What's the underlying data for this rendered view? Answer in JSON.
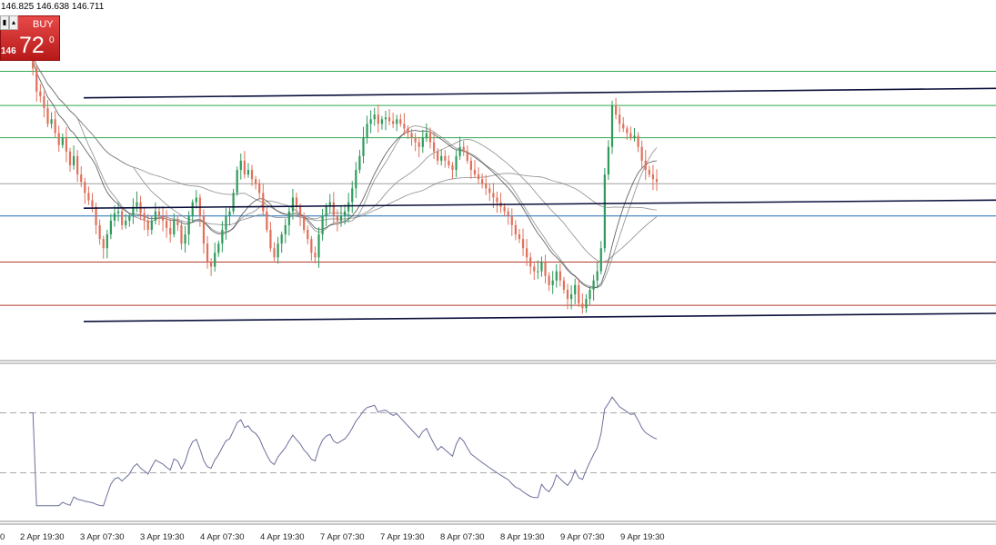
{
  "header": {
    "ohlc_text": "146.825 146.638 146.711"
  },
  "trade_panel": {
    "buy_label": "BUY",
    "price_small": "146",
    "price_big": "72",
    "price_sup": "0",
    "sell_icon": "minus-box-icon",
    "up_icon": "up-arrow-icon",
    "buy_color": "#d22b2b"
  },
  "chart_data": {
    "type": "candlestick",
    "time_axis_labels": [
      "0",
      "2 Apr 19:30",
      "3 Apr 07:30",
      "3 Apr 19:30",
      "4 Apr 07:30",
      "4 Apr 19:30",
      "7 Apr 07:30",
      "7 Apr 19:30",
      "8 Apr 07:30",
      "8 Apr 19:30",
      "9 Apr 07:30",
      "9 Apr 19:30"
    ],
    "price_scale": {
      "min": 145.0,
      "max": 148.5
    },
    "horizontal_levels": [
      {
        "price": 148.12,
        "color": "#2fa84f"
      },
      {
        "price": 147.75,
        "color": "#2fa84f"
      },
      {
        "price": 147.4,
        "color": "#2fa84f"
      },
      {
        "price": 146.9,
        "color": "#a0a0a0"
      },
      {
        "price": 146.55,
        "color": "#1f6fb5"
      },
      {
        "price": 146.05,
        "color": "#b23a2a"
      },
      {
        "price": 145.58,
        "color": "#b23a2a"
      }
    ],
    "trend_lines": [
      {
        "from": [
          58,
          147.85
        ],
        "to": [
          700,
          148.12
        ]
      },
      {
        "from": [
          58,
          146.65
        ],
        "to": [
          700,
          146.88
        ]
      },
      {
        "from": [
          58,
          145.42
        ],
        "to": [
          700,
          145.65
        ]
      }
    ],
    "close_prices": [
      148.4,
      148.3,
      148.15,
      147.9,
      147.85,
      147.72,
      147.55,
      147.6,
      147.45,
      147.32,
      147.4,
      147.25,
      147.1,
      147.2,
      147.0,
      146.92,
      146.8,
      146.72,
      146.65,
      146.45,
      146.3,
      146.2,
      146.35,
      146.5,
      146.58,
      146.6,
      146.45,
      146.5,
      146.55,
      146.65,
      146.7,
      146.58,
      146.5,
      146.4,
      146.5,
      146.6,
      146.55,
      146.5,
      146.42,
      146.35,
      146.5,
      146.45,
      146.25,
      146.35,
      146.55,
      146.7,
      146.75,
      146.55,
      146.25,
      146.05,
      146.0,
      146.15,
      146.25,
      146.4,
      146.55,
      146.6,
      146.8,
      147.05,
      147.15,
      147.0,
      147.05,
      146.95,
      146.9,
      146.8,
      146.6,
      146.4,
      146.2,
      146.1,
      146.25,
      146.35,
      146.45,
      146.6,
      146.75,
      146.65,
      146.55,
      146.4,
      146.3,
      146.15,
      146.1,
      146.35,
      146.55,
      146.65,
      146.7,
      146.55,
      146.5,
      146.55,
      146.6,
      146.7,
      146.85,
      147.05,
      147.2,
      147.4,
      147.55,
      147.6,
      147.65,
      147.55,
      147.6,
      147.62,
      147.58,
      147.55,
      147.6,
      147.55,
      147.5,
      147.45,
      147.4,
      147.35,
      147.3,
      147.4,
      147.45,
      147.35,
      147.25,
      147.15,
      147.2,
      147.15,
      147.1,
      147.05,
      147.2,
      147.3,
      147.25,
      147.15,
      147.05,
      147.0,
      146.95,
      146.9,
      146.85,
      146.8,
      146.75,
      146.7,
      146.65,
      146.6,
      146.55,
      146.45,
      146.35,
      146.3,
      146.2,
      146.1,
      146.0,
      145.95,
      145.95,
      146.05,
      145.9,
      145.8,
      145.85,
      145.95,
      145.85,
      145.75,
      145.65,
      145.7,
      145.8,
      145.6,
      145.55,
      145.65,
      145.75,
      145.85,
      145.95,
      146.2,
      147.0,
      147.3,
      147.75,
      147.65,
      147.55,
      147.5,
      147.45,
      147.4,
      147.42,
      147.3,
      147.15,
      147.05,
      147.0,
      146.95,
      146.92
    ],
    "moving_averages": [
      {
        "color": "#808080"
      },
      {
        "color": "#808080"
      },
      {
        "color": "#808080"
      },
      {
        "color": "#404040"
      }
    ],
    "bull_color": "#2e9b5b",
    "bear_color": "#e0705a",
    "indicator": {
      "type": "line",
      "color": "#6b6f9a",
      "levels": [
        70,
        30
      ],
      "range": [
        0,
        100
      ]
    }
  }
}
